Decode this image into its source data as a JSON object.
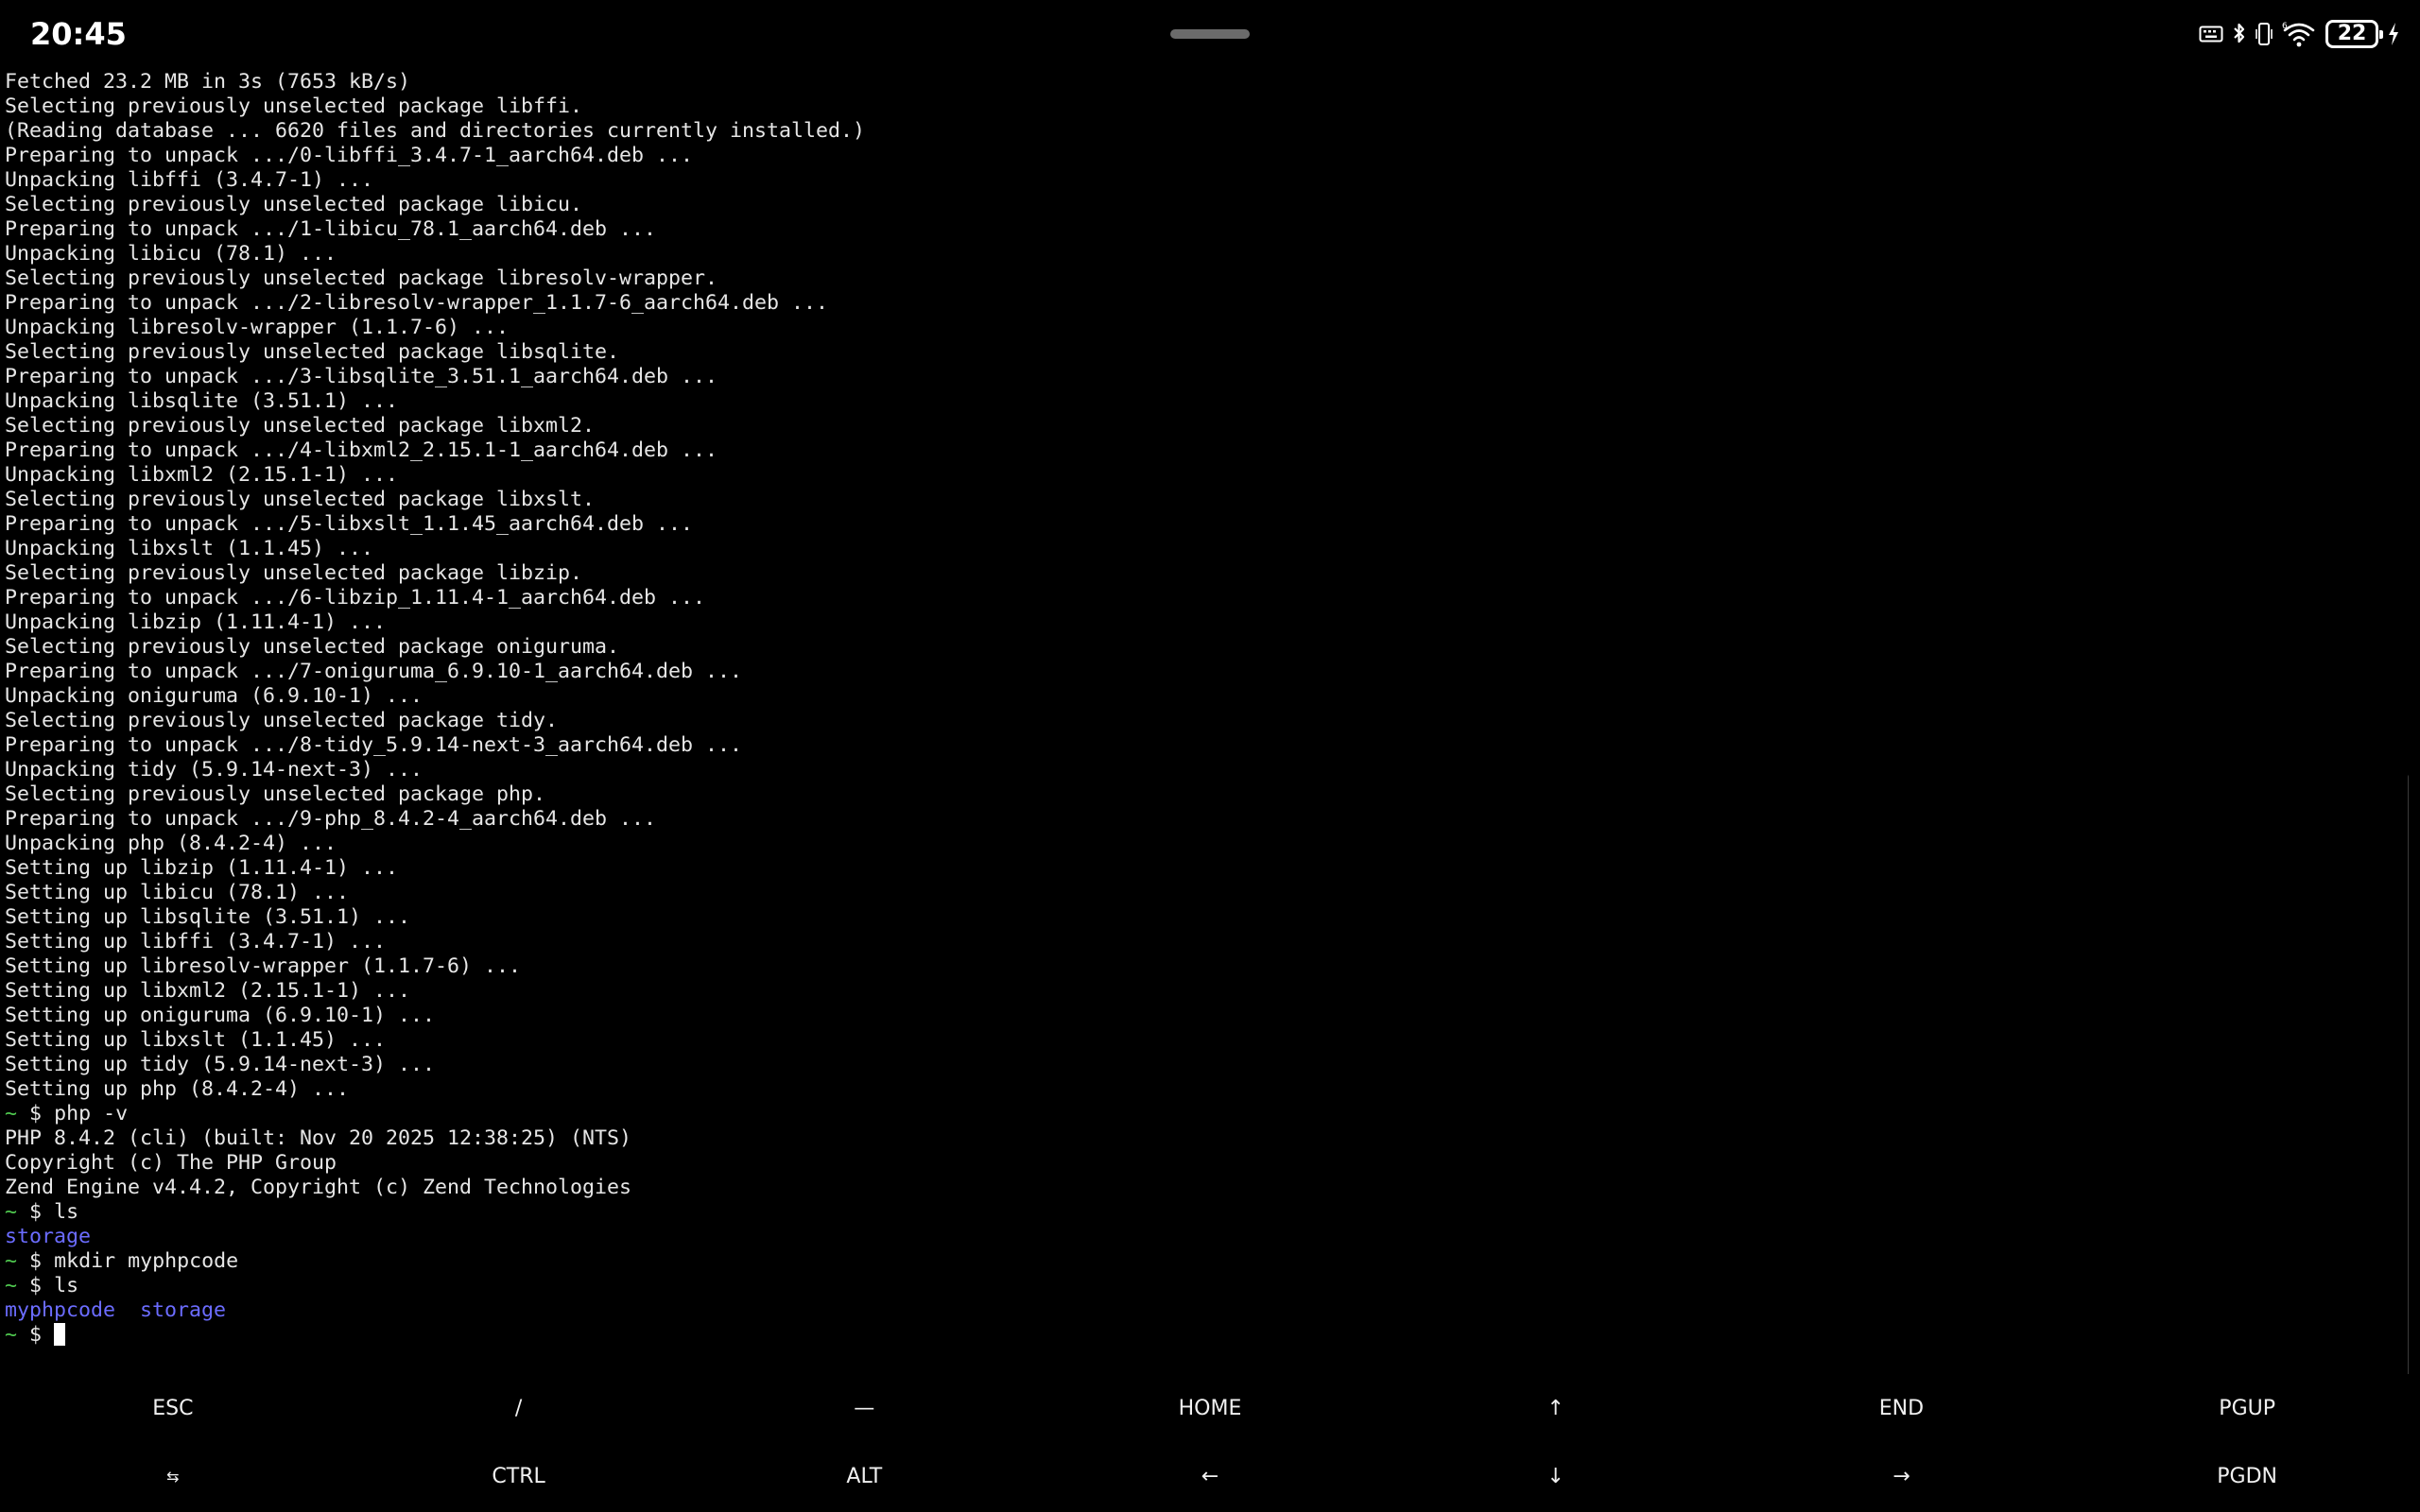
{
  "status_bar": {
    "time": "20:45",
    "battery_level": "22",
    "icons": [
      "keyboard-icon",
      "bluetooth-icon",
      "phone-vibrate-icon",
      "wifi-6-icon",
      "battery-icon",
      "charging-bolt-icon"
    ]
  },
  "terminal": {
    "lines": [
      {
        "type": "out",
        "text": "Fetched 23.2 MB in 3s (7653 kB/s)"
      },
      {
        "type": "out",
        "text": "Selecting previously unselected package libffi."
      },
      {
        "type": "out",
        "text": "(Reading database ... 6620 files and directories currently installed.)"
      },
      {
        "type": "out",
        "text": "Preparing to unpack .../0-libffi_3.4.7-1_aarch64.deb ..."
      },
      {
        "type": "out",
        "text": "Unpacking libffi (3.4.7-1) ..."
      },
      {
        "type": "out",
        "text": "Selecting previously unselected package libicu."
      },
      {
        "type": "out",
        "text": "Preparing to unpack .../1-libicu_78.1_aarch64.deb ..."
      },
      {
        "type": "out",
        "text": "Unpacking libicu (78.1) ..."
      },
      {
        "type": "out",
        "text": "Selecting previously unselected package libresolv-wrapper."
      },
      {
        "type": "out",
        "text": "Preparing to unpack .../2-libresolv-wrapper_1.1.7-6_aarch64.deb ..."
      },
      {
        "type": "out",
        "text": "Unpacking libresolv-wrapper (1.1.7-6) ..."
      },
      {
        "type": "out",
        "text": "Selecting previously unselected package libsqlite."
      },
      {
        "type": "out",
        "text": "Preparing to unpack .../3-libsqlite_3.51.1_aarch64.deb ..."
      },
      {
        "type": "out",
        "text": "Unpacking libsqlite (3.51.1) ..."
      },
      {
        "type": "out",
        "text": "Selecting previously unselected package libxml2."
      },
      {
        "type": "out",
        "text": "Preparing to unpack .../4-libxml2_2.15.1-1_aarch64.deb ..."
      },
      {
        "type": "out",
        "text": "Unpacking libxml2 (2.15.1-1) ..."
      },
      {
        "type": "out",
        "text": "Selecting previously unselected package libxslt."
      },
      {
        "type": "out",
        "text": "Preparing to unpack .../5-libxslt_1.1.45_aarch64.deb ..."
      },
      {
        "type": "out",
        "text": "Unpacking libxslt (1.1.45) ..."
      },
      {
        "type": "out",
        "text": "Selecting previously unselected package libzip."
      },
      {
        "type": "out",
        "text": "Preparing to unpack .../6-libzip_1.11.4-1_aarch64.deb ..."
      },
      {
        "type": "out",
        "text": "Unpacking libzip (1.11.4-1) ..."
      },
      {
        "type": "out",
        "text": "Selecting previously unselected package oniguruma."
      },
      {
        "type": "out",
        "text": "Preparing to unpack .../7-oniguruma_6.9.10-1_aarch64.deb ..."
      },
      {
        "type": "out",
        "text": "Unpacking oniguruma (6.9.10-1) ..."
      },
      {
        "type": "out",
        "text": "Selecting previously unselected package tidy."
      },
      {
        "type": "out",
        "text": "Preparing to unpack .../8-tidy_5.9.14-next-3_aarch64.deb ..."
      },
      {
        "type": "out",
        "text": "Unpacking tidy (5.9.14-next-3) ..."
      },
      {
        "type": "out",
        "text": "Selecting previously unselected package php."
      },
      {
        "type": "out",
        "text": "Preparing to unpack .../9-php_8.4.2-4_aarch64.deb ..."
      },
      {
        "type": "out",
        "text": "Unpacking php (8.4.2-4) ..."
      },
      {
        "type": "out",
        "text": "Setting up libzip (1.11.4-1) ..."
      },
      {
        "type": "out",
        "text": "Setting up libicu (78.1) ..."
      },
      {
        "type": "out",
        "text": "Setting up libsqlite (3.51.1) ..."
      },
      {
        "type": "out",
        "text": "Setting up libffi (3.4.7-1) ..."
      },
      {
        "type": "out",
        "text": "Setting up libresolv-wrapper (1.1.7-6) ..."
      },
      {
        "type": "out",
        "text": "Setting up libxml2 (2.15.1-1) ..."
      },
      {
        "type": "out",
        "text": "Setting up oniguruma (6.9.10-1) ..."
      },
      {
        "type": "out",
        "text": "Setting up libxslt (1.1.45) ..."
      },
      {
        "type": "out",
        "text": "Setting up tidy (5.9.14-next-3) ..."
      },
      {
        "type": "out",
        "text": "Setting up php (8.4.2-4) ..."
      },
      {
        "type": "cmd",
        "tilde": "~",
        "dollar": "$",
        "text": "php -v"
      },
      {
        "type": "out",
        "text": "PHP 8.4.2 (cli) (built: Nov 20 2025 12:38:25) (NTS)"
      },
      {
        "type": "out",
        "text": "Copyright (c) The PHP Group"
      },
      {
        "type": "out",
        "text": "Zend Engine v4.4.2, Copyright (c) Zend Technologies"
      },
      {
        "type": "cmd",
        "tilde": "~",
        "dollar": "$",
        "text": "ls"
      },
      {
        "type": "dirs",
        "items": [
          "storage"
        ]
      },
      {
        "type": "cmd",
        "tilde": "~",
        "dollar": "$",
        "text": "mkdir myphpcode"
      },
      {
        "type": "cmd",
        "tilde": "~",
        "dollar": "$",
        "text": "ls"
      },
      {
        "type": "dirs",
        "items": [
          "myphpcode",
          "storage"
        ]
      },
      {
        "type": "prompt",
        "tilde": "~",
        "dollar": "$"
      }
    ],
    "colors": {
      "text": "#e6e6e6",
      "prompt_tilde": "#4fc94f",
      "directory": "#6b6cff",
      "background": "#000000"
    }
  },
  "extra_keys": {
    "row1": [
      {
        "label": "ESC",
        "name": "esc-key"
      },
      {
        "label": "/",
        "name": "slash-key"
      },
      {
        "label": "—",
        "name": "dash-key"
      },
      {
        "label": "HOME",
        "name": "home-key"
      },
      {
        "label": "↑",
        "name": "up-arrow-key"
      },
      {
        "label": "END",
        "name": "end-key"
      },
      {
        "label": "PGUP",
        "name": "pgup-key"
      }
    ],
    "row2": [
      {
        "label": "⇆",
        "name": "tab-key",
        "small": true
      },
      {
        "label": "CTRL",
        "name": "ctrl-key"
      },
      {
        "label": "ALT",
        "name": "alt-key"
      },
      {
        "label": "←",
        "name": "left-arrow-key"
      },
      {
        "label": "↓",
        "name": "down-arrow-key"
      },
      {
        "label": "→",
        "name": "right-arrow-key"
      },
      {
        "label": "PGDN",
        "name": "pgdn-key"
      }
    ]
  }
}
